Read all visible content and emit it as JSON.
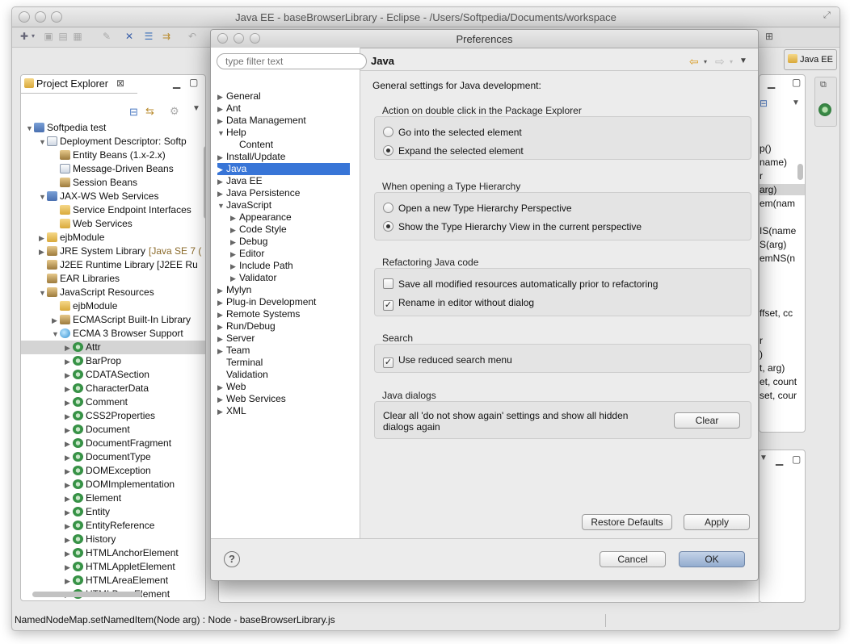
{
  "window": {
    "title": "Java EE - baseBrowserLibrary - Eclipse - /Users/Softpedia/Documents/workspace"
  },
  "perspective": {
    "label": "Java EE"
  },
  "project_explorer": {
    "tab_label": "Project Explorer",
    "tree": [
      {
        "label": "Softpedia test",
        "indent": 0,
        "toggle": "▼",
        "icon": "project-icon"
      },
      {
        "label": "Deployment Descriptor: Softp",
        "indent": 1,
        "toggle": "▼",
        "icon": "descriptor-icon"
      },
      {
        "label": "Entity Beans (1.x-2.x)",
        "indent": 2,
        "toggle": "",
        "icon": "entity-beans-icon"
      },
      {
        "label": "Message-Driven Beans",
        "indent": 2,
        "toggle": "",
        "icon": "message-beans-icon"
      },
      {
        "label": "Session Beans",
        "indent": 2,
        "toggle": "",
        "icon": "session-beans-icon"
      },
      {
        "label": "JAX-WS Web Services",
        "indent": 1,
        "toggle": "▼",
        "icon": "web-services-icon"
      },
      {
        "label": "Service Endpoint Interfaces",
        "indent": 2,
        "toggle": "",
        "icon": "folder-icon"
      },
      {
        "label": "Web Services",
        "indent": 2,
        "toggle": "",
        "icon": "folder-icon"
      },
      {
        "label": "ejbModule",
        "indent": 1,
        "toggle": "▶",
        "icon": "folder-icon"
      },
      {
        "label": "JRE System Library",
        "suffix": "[Java SE 7 (",
        "indent": 1,
        "toggle": "▶",
        "icon": "library-icon"
      },
      {
        "label": "J2EE Runtime Library [J2EE Ru",
        "indent": 1,
        "toggle": "",
        "icon": "library-icon"
      },
      {
        "label": "EAR Libraries",
        "indent": 1,
        "toggle": "",
        "icon": "library-icon"
      },
      {
        "label": "JavaScript Resources",
        "indent": 1,
        "toggle": "▼",
        "icon": "library-icon"
      },
      {
        "label": "ejbModule",
        "indent": 2,
        "toggle": "",
        "icon": "folder-icon"
      },
      {
        "label": "ECMAScript Built-In Library",
        "indent": 2,
        "toggle": "▶",
        "icon": "library-icon"
      },
      {
        "label": "ECMA 3 Browser Support",
        "indent": 2,
        "toggle": "▼",
        "icon": "globe-icon"
      },
      {
        "label": "Attr",
        "indent": 3,
        "toggle": "▶",
        "icon": "class-icon",
        "selected": true
      },
      {
        "label": "BarProp",
        "indent": 3,
        "toggle": "▶",
        "icon": "class-icon"
      },
      {
        "label": "CDATASection",
        "indent": 3,
        "toggle": "▶",
        "icon": "class-icon"
      },
      {
        "label": "CharacterData",
        "indent": 3,
        "toggle": "▶",
        "icon": "class-icon"
      },
      {
        "label": "Comment",
        "indent": 3,
        "toggle": "▶",
        "icon": "class-icon"
      },
      {
        "label": "CSS2Properties",
        "indent": 3,
        "toggle": "▶",
        "icon": "class-icon"
      },
      {
        "label": "Document",
        "indent": 3,
        "toggle": "▶",
        "icon": "class-icon"
      },
      {
        "label": "DocumentFragment",
        "indent": 3,
        "toggle": "▶",
        "icon": "class-icon"
      },
      {
        "label": "DocumentType",
        "indent": 3,
        "toggle": "▶",
        "icon": "class-icon"
      },
      {
        "label": "DOMException",
        "indent": 3,
        "toggle": "▶",
        "icon": "class-icon"
      },
      {
        "label": "DOMImplementation",
        "indent": 3,
        "toggle": "▶",
        "icon": "class-icon"
      },
      {
        "label": "Element",
        "indent": 3,
        "toggle": "▶",
        "icon": "class-icon"
      },
      {
        "label": "Entity",
        "indent": 3,
        "toggle": "▶",
        "icon": "class-icon"
      },
      {
        "label": "EntityReference",
        "indent": 3,
        "toggle": "▶",
        "icon": "class-icon"
      },
      {
        "label": "History",
        "indent": 3,
        "toggle": "▶",
        "icon": "class-icon"
      },
      {
        "label": "HTMLAnchorElement",
        "indent": 3,
        "toggle": "▶",
        "icon": "class-icon"
      },
      {
        "label": "HTMLAppletElement",
        "indent": 3,
        "toggle": "▶",
        "icon": "class-icon"
      },
      {
        "label": "HTMLAreaElement",
        "indent": 3,
        "toggle": "▶",
        "icon": "class-icon"
      },
      {
        "label": "HTMLBaseElement",
        "indent": 3,
        "toggle": "▶",
        "icon": "class-icon"
      }
    ]
  },
  "outline_fragments": [
    "p()",
    "name)",
    "r",
    "arg)",
    "em(nam",
    "",
    "IS(name",
    "S(arg)",
    "emNS(n",
    "",
    "",
    "",
    "ffset, cc",
    "",
    "r",
    ")",
    "t, arg)",
    "et, count",
    "set, cour"
  ],
  "status_bar": {
    "text": "NamedNodeMap.setNamedItem(Node arg) : Node - baseBrowserLibrary.js"
  },
  "preferences": {
    "title": "Preferences",
    "filter_placeholder": "type filter text",
    "nav": [
      {
        "label": "General",
        "indent": 0,
        "toggle": "▶"
      },
      {
        "label": "Ant",
        "indent": 0,
        "toggle": "▶"
      },
      {
        "label": "Data Management",
        "indent": 0,
        "toggle": "▶"
      },
      {
        "label": "Help",
        "indent": 0,
        "toggle": "▼"
      },
      {
        "label": "Content",
        "indent": 1,
        "toggle": ""
      },
      {
        "label": "Install/Update",
        "indent": 0,
        "toggle": "▶"
      },
      {
        "label": "Java",
        "indent": 0,
        "toggle": "▶",
        "selected": true
      },
      {
        "label": "Java EE",
        "indent": 0,
        "toggle": "▶"
      },
      {
        "label": "Java Persistence",
        "indent": 0,
        "toggle": "▶"
      },
      {
        "label": "JavaScript",
        "indent": 0,
        "toggle": "▼"
      },
      {
        "label": "Appearance",
        "indent": 1,
        "toggle": "▶"
      },
      {
        "label": "Code Style",
        "indent": 1,
        "toggle": "▶"
      },
      {
        "label": "Debug",
        "indent": 1,
        "toggle": "▶"
      },
      {
        "label": "Editor",
        "indent": 1,
        "toggle": "▶"
      },
      {
        "label": "Include Path",
        "indent": 1,
        "toggle": "▶"
      },
      {
        "label": "Validator",
        "indent": 1,
        "toggle": "▶"
      },
      {
        "label": "Mylyn",
        "indent": 0,
        "toggle": "▶"
      },
      {
        "label": "Plug-in Development",
        "indent": 0,
        "toggle": "▶"
      },
      {
        "label": "Remote Systems",
        "indent": 0,
        "toggle": "▶"
      },
      {
        "label": "Run/Debug",
        "indent": 0,
        "toggle": "▶"
      },
      {
        "label": "Server",
        "indent": 0,
        "toggle": "▶"
      },
      {
        "label": "Team",
        "indent": 0,
        "toggle": "▶"
      },
      {
        "label": "Terminal",
        "indent": 0,
        "toggle": ""
      },
      {
        "label": "Validation",
        "indent": 0,
        "toggle": ""
      },
      {
        "label": "Web",
        "indent": 0,
        "toggle": "▶"
      },
      {
        "label": "Web Services",
        "indent": 0,
        "toggle": "▶"
      },
      {
        "label": "XML",
        "indent": 0,
        "toggle": "▶"
      }
    ],
    "page": {
      "title": "Java",
      "description": "General settings for Java development:",
      "double_click": {
        "label": "Action on double click in the Package Explorer",
        "options": [
          {
            "label": "Go into the selected element",
            "checked": false
          },
          {
            "label": "Expand the selected element",
            "checked": true
          }
        ]
      },
      "type_hierarchy": {
        "label": "When opening a Type Hierarchy",
        "options": [
          {
            "label": "Open a new Type Hierarchy Perspective",
            "checked": false
          },
          {
            "label": "Show the Type Hierarchy View in the current perspective",
            "checked": true
          }
        ]
      },
      "refactoring": {
        "label": "Refactoring Java code",
        "options": [
          {
            "label": "Save all modified resources automatically prior to refactoring",
            "checked": false
          },
          {
            "label": "Rename in editor without dialog",
            "checked": true
          }
        ]
      },
      "search": {
        "label": "Search",
        "options": [
          {
            "label": "Use reduced search menu",
            "checked": true
          }
        ]
      },
      "java_dialogs": {
        "label": "Java dialogs",
        "text": "Clear all 'do not show again' settings and show all hidden dialogs again",
        "button": "Clear"
      }
    },
    "buttons": {
      "restore_defaults": "Restore Defaults",
      "apply": "Apply",
      "cancel": "Cancel",
      "ok": "OK",
      "help": "?"
    }
  }
}
